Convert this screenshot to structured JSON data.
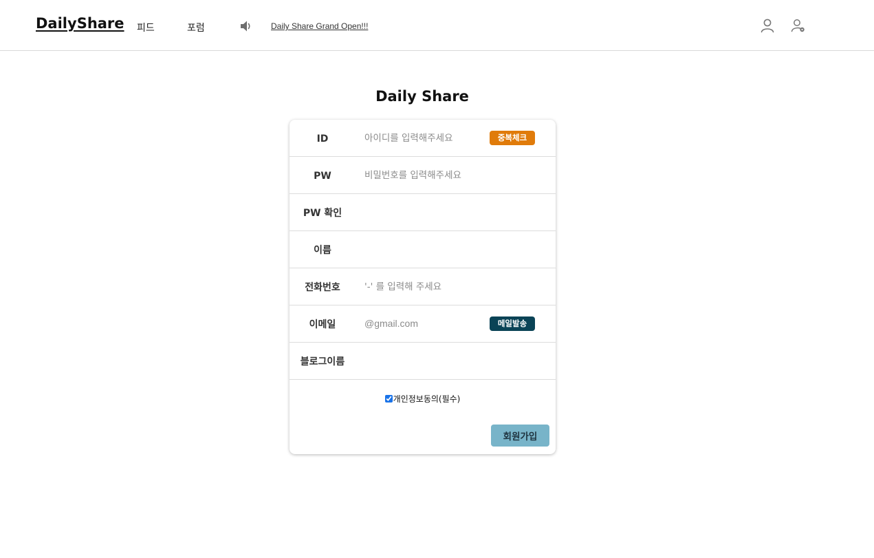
{
  "header": {
    "logo": "DailyShare",
    "nav": {
      "feed": "피드",
      "forum": "포럼"
    },
    "notice_icon": "speaker-icon",
    "notice": "Daily Share Grand Open!!!",
    "icons": [
      "user-icon",
      "user-settings-icon"
    ]
  },
  "main": {
    "title": "Daily Share"
  },
  "form": {
    "id": {
      "label": "ID",
      "placeholder": "아이디를 입력해주세요",
      "button": "중복체크"
    },
    "pw": {
      "label": "PW",
      "placeholder": "비밀번호를 입력해주세요"
    },
    "pw_confirm": {
      "label": "PW 확인",
      "placeholder": ""
    },
    "name": {
      "label": "이름",
      "placeholder": ""
    },
    "phone": {
      "label": "전화번호",
      "placeholder": "'-' 를 입력해 주세요"
    },
    "email": {
      "label": "이메일",
      "placeholder": "@gmail.com",
      "button": "메일발송"
    },
    "blog": {
      "label": "블로그이름",
      "placeholder": ""
    },
    "consent": {
      "label": "개인정보동의(필수)",
      "checked": true
    },
    "submit": "회원가입"
  },
  "colors": {
    "duplicate_check": "#e07b0a",
    "send_mail": "#0a4356",
    "signup": "#78b4c9"
  }
}
